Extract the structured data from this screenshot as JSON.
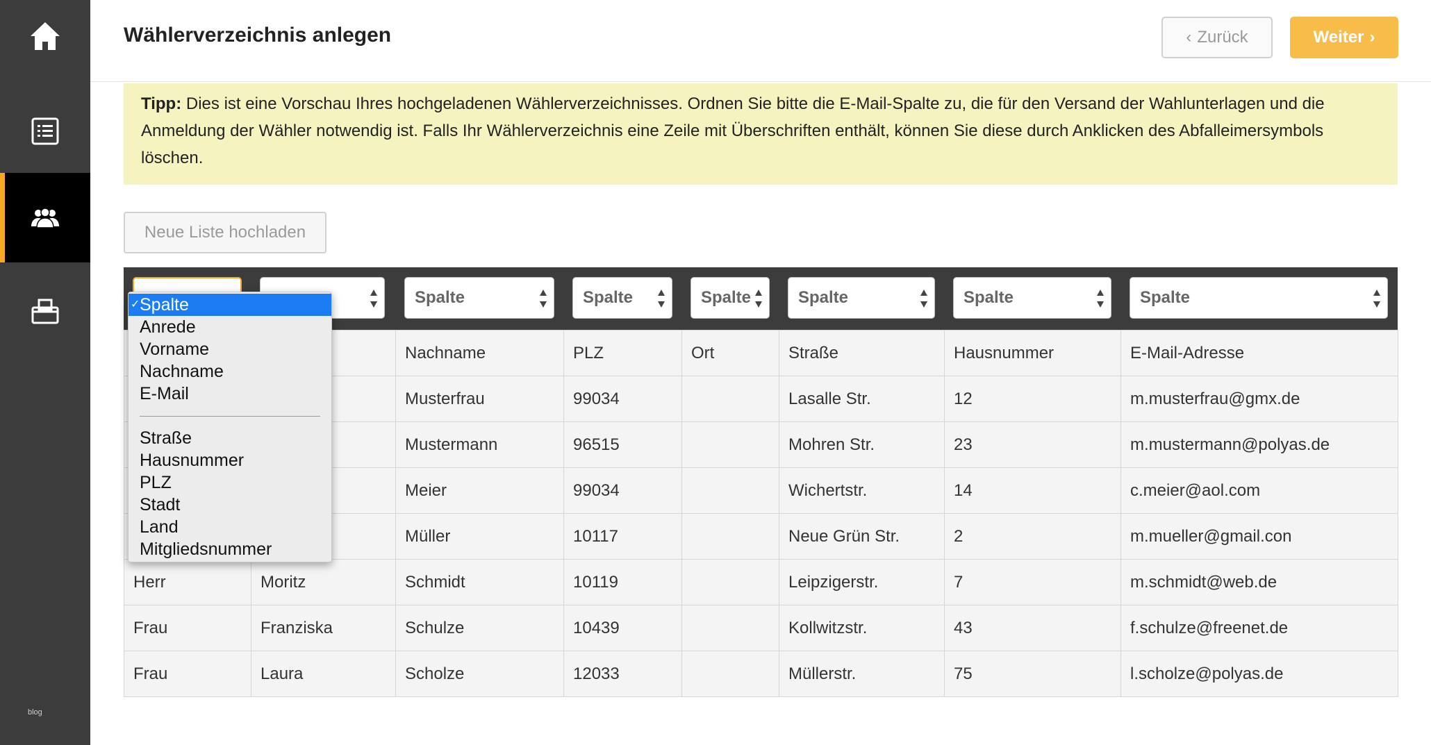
{
  "sidebar": {
    "items": [
      {
        "name": "home",
        "icon": "home-icon"
      },
      {
        "name": "list",
        "icon": "list-icon"
      },
      {
        "name": "users",
        "icon": "users-icon",
        "active": true
      },
      {
        "name": "ballot-box",
        "icon": "ballot-box-icon"
      }
    ],
    "footer_label": "blog",
    "accent_color": "#f7a823"
  },
  "header": {
    "title": "Wählerverzeichnis anlegen",
    "back_label": "Zurück",
    "next_label": "Weiter"
  },
  "tip": {
    "label": "Tipp:",
    "text": "Dies ist eine Vorschau Ihres hochgeladenen Wählerverzeichnisses. Ordnen Sie bitte die E-Mail-Spalte zu, die für den Versand der Wahlunterlagen und die Anmeldung der Wähler notwendig ist. Falls Ihr Wählerverzeichnis eine Zeile mit Überschriften enthält, können Sie diese durch Anklicken des Abfalleimersymbols löschen."
  },
  "upload_label": "Neue Liste hochladen",
  "table": {
    "column_selects": [
      "",
      "",
      "Spalte",
      "Spalte",
      "Spalte",
      "Spalte",
      "Spalte",
      "Spalte"
    ],
    "rows": [
      [
        "",
        "",
        "Nachname",
        "PLZ",
        "Ort",
        "Straße",
        "Hausnummer",
        "E-Mail-Adresse"
      ],
      [
        "",
        "",
        "Musterfrau",
        "99034",
        "",
        "Lasalle Str.",
        "12",
        "m.musterfrau@gmx.de"
      ],
      [
        "",
        "",
        "Mustermann",
        "96515",
        "",
        "Mohren Str.",
        "23",
        "m.mustermann@polyas.de"
      ],
      [
        "",
        "",
        "Meier",
        "99034",
        "",
        "Wichertstr.",
        "14",
        "c.meier@aol.com"
      ],
      [
        "",
        "",
        "Müller",
        "10117",
        "",
        "Neue Grün Str.",
        "2",
        "m.mueller@gmail.con"
      ],
      [
        "Herr",
        "Moritz",
        "Schmidt",
        "10119",
        "",
        "Leipzigerstr.",
        "7",
        "m.schmidt@web.de"
      ],
      [
        "Frau",
        "Franziska",
        "Schulze",
        "10439",
        "",
        "Kollwitzstr.",
        "43",
        "f.schulze@freenet.de"
      ],
      [
        "Frau",
        "Laura",
        "Scholze",
        "12033",
        "",
        "Müllerstr.",
        "75",
        "l.scholze@polyas.de"
      ]
    ]
  },
  "dropdown": {
    "selected": "Spalte",
    "items_top": [
      "Anrede",
      "Vorname",
      "Nachname",
      "E-Mail"
    ],
    "items_bottom": [
      "Straße",
      "Hausnummer",
      "PLZ",
      "Stadt",
      "Land",
      "Mitgliedsnummer"
    ]
  }
}
